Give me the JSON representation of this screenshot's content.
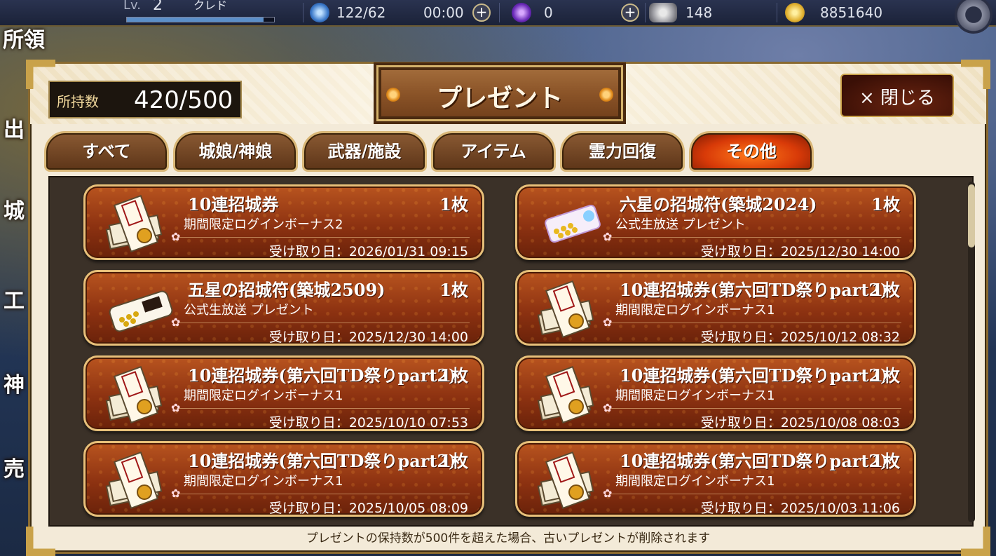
{
  "top_bar": {
    "level_label": "Lv.",
    "level_value": "2",
    "player_name": "クレド",
    "level_progress": 0.93,
    "stamina": "122/62",
    "stamina_timer": "00:00",
    "orb_count": "0",
    "cash_count": "148",
    "gold_count": "8851640"
  },
  "side_menu": [
    "所領",
    "出",
    "城",
    "工",
    "神",
    "売"
  ],
  "dialog": {
    "owned_label": "所持数",
    "owned_value": "420/500",
    "title": "プレゼント",
    "close_label": "× 閉じる",
    "tabs": [
      {
        "label": "すべて",
        "active": false
      },
      {
        "label": "城娘/神娘",
        "active": false
      },
      {
        "label": "武器/施設",
        "active": false
      },
      {
        "label": "アイテム",
        "active": false
      },
      {
        "label": "霊力回復",
        "active": false
      },
      {
        "label": "その他",
        "active": true
      }
    ],
    "items": [
      {
        "icon": "ticket-bundle-icon",
        "name": "10連招城券",
        "qty": "1枚",
        "source": "期間限定ログインボーナス2",
        "date": "受け取り日：2026/01/31  09:15"
      },
      {
        "icon": "six-star-charm-icon",
        "name": "六星の招城符(築城2024)",
        "qty": "1枚",
        "source": "公式生放送 プレゼント",
        "date": "受け取り日：2025/12/30  14:00"
      },
      {
        "icon": "five-star-charm-icon",
        "name": "五星の招城符(築城2509)",
        "qty": "1枚",
        "source": "公式生放送 プレゼント",
        "date": "受け取り日：2025/12/30  14:00"
      },
      {
        "icon": "ticket-bundle-icon",
        "name": "10連招城券(第六回TD祭りpart2)",
        "qty": "1枚",
        "source": "期間限定ログインボーナス1",
        "date": "受け取り日：2025/10/12  08:32"
      },
      {
        "icon": "ticket-bundle-icon",
        "name": "10連招城券(第六回TD祭りpart2)",
        "qty": "1枚",
        "source": "期間限定ログインボーナス1",
        "date": "受け取り日：2025/10/10  07:53"
      },
      {
        "icon": "ticket-bundle-icon",
        "name": "10連招城券(第六回TD祭りpart2)",
        "qty": "1枚",
        "source": "期間限定ログインボーナス1",
        "date": "受け取り日：2025/10/08  08:03"
      },
      {
        "icon": "ticket-bundle-icon",
        "name": "10連招城券(第六回TD祭りpart2)",
        "qty": "1枚",
        "source": "期間限定ログインボーナス1",
        "date": "受け取り日：2025/10/05  08:09"
      },
      {
        "icon": "ticket-bundle-icon",
        "name": "10連招城券(第六回TD祭りpart2)",
        "qty": "1枚",
        "source": "期間限定ログインボーナス1",
        "date": "受け取り日：2025/10/03  11:06"
      }
    ],
    "footer_note": "プレゼントの保持数が500件を超えた場合、古いプレゼントが削除されます"
  },
  "colors": {
    "accent_gold": "#c9a24a",
    "card_orange": "#b8541f",
    "active_tab": "#e0400a"
  }
}
